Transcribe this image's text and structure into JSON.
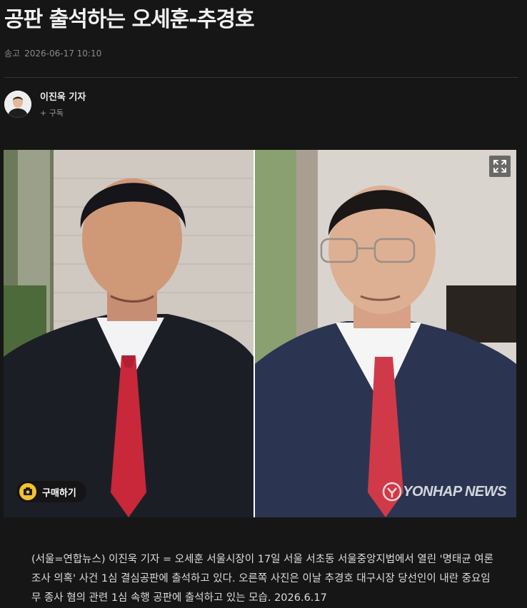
{
  "article": {
    "title": "공판 출석하는 오세훈-추경호",
    "meta_label": "송고",
    "timestamp": "2026-06-17 10:10"
  },
  "byline": {
    "reporter": "이진욱 기자",
    "subscribe_label": "+ 구독"
  },
  "photo": {
    "buy_label": "구매하기",
    "watermark": "YONHAP NEWS",
    "expand_icon": "expand-icon",
    "buy_icon": "cart-icon"
  },
  "caption": "(서울=연합뉴스) 이진욱 기자 = 오세훈 서울시장이 17일 서울 서초동 서울중앙지법에서 열린 '명태균 여론조사 의혹' 사건 1심 결심공판에 출석하고 있다. 오른쪽 사진은 이날 추경호 대구시장 당선인이 내란 중요임무 종사 혐의 관련 1심 속행 공판에 출석하고 있는 모습. 2026.6.17",
  "colors": {
    "background": "#161616",
    "tie": "#c8283a",
    "badge": "#f2c230"
  }
}
